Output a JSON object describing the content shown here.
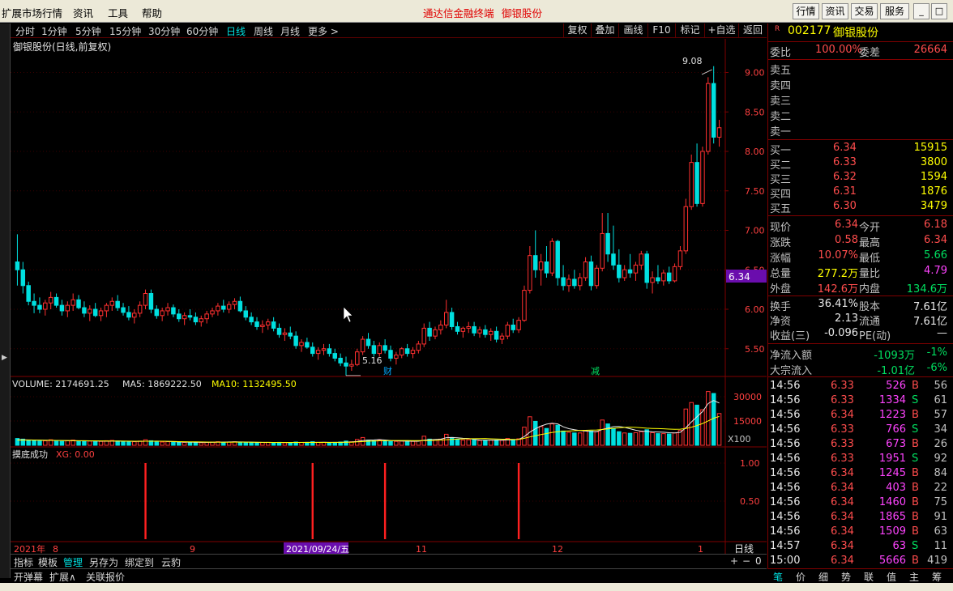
{
  "menubar": {
    "items": [
      "扩展市场行情",
      "资讯",
      "工具",
      "帮助"
    ],
    "title_app": "通达信金融终端",
    "title_stock": "御银股份",
    "right_buttons": [
      "行情",
      "资讯",
      "交易",
      "服务"
    ],
    "window_controls": [
      "_",
      "□",
      "×"
    ]
  },
  "periods": [
    "分时",
    "1分钟",
    "5分钟",
    "15分钟",
    "30分钟",
    "60分钟",
    "日线",
    "周线",
    "月线",
    "更多 >"
  ],
  "active_period": "日线",
  "toolbar": [
    "复权",
    "叠加",
    "画线",
    "F10",
    "标记",
    "+自选",
    "返回"
  ],
  "chart_title": "御银股份(日线,前复权)",
  "chart_data": {
    "type": "candlestick",
    "price_axis": [
      "9.00",
      "8.50",
      "8.00",
      "7.50",
      "7.00",
      "6.50",
      "6.00",
      "5.50"
    ],
    "price_ylim": [
      5.2,
      9.2
    ],
    "current_price_label": "6.34",
    "annotations": {
      "high": "9.08",
      "low": "5.16",
      "markers": [
        "财",
        "减"
      ]
    },
    "volume_label": "VOLUME: 2174691.25",
    "ma5_label": "MA5: 1869222.50",
    "ma10_label": "MA10: 1132495.50",
    "volume_axis": [
      "30000",
      "15000"
    ],
    "volume_unit": "X100",
    "indicator_title": "摸底成功",
    "indicator_value": "XG: 0.00",
    "indicator_axis": [
      "1.00",
      "0.50"
    ],
    "x_labels": [
      "2021年",
      "8",
      "9",
      "2021/09/24/五",
      "11",
      "12",
      "1"
    ],
    "period_label": "日线",
    "candles": [
      [
        6.6,
        6.95,
        6.3,
        6.5
      ],
      [
        6.5,
        6.6,
        6.2,
        6.3
      ],
      [
        6.3,
        6.35,
        6.05,
        6.1
      ],
      [
        6.1,
        6.2,
        5.95,
        6.05
      ],
      [
        6.05,
        6.15,
        5.95,
        6.0
      ],
      [
        6.0,
        6.12,
        5.92,
        6.08
      ],
      [
        6.08,
        6.22,
        6.0,
        6.15
      ],
      [
        6.15,
        6.2,
        6.02,
        6.05
      ],
      [
        6.05,
        6.12,
        5.92,
        5.98
      ],
      [
        5.98,
        6.1,
        5.9,
        6.05
      ],
      [
        6.05,
        6.2,
        5.98,
        6.12
      ],
      [
        6.12,
        6.18,
        6.0,
        6.02
      ],
      [
        6.02,
        6.1,
        5.9,
        5.95
      ],
      [
        5.95,
        6.05,
        5.85,
        6.0
      ],
      [
        6.0,
        6.08,
        5.9,
        5.92
      ],
      [
        5.92,
        6.02,
        5.85,
        5.98
      ],
      [
        5.98,
        6.08,
        5.9,
        6.05
      ],
      [
        6.05,
        6.15,
        5.98,
        6.1
      ],
      [
        6.1,
        6.18,
        5.98,
        6.02
      ],
      [
        6.02,
        6.08,
        5.92,
        5.96
      ],
      [
        5.96,
        6.04,
        5.86,
        5.9
      ],
      [
        5.9,
        6.0,
        5.82,
        5.95
      ],
      [
        5.95,
        6.1,
        5.9,
        6.05
      ],
      [
        6.05,
        6.25,
        6.0,
        6.2
      ],
      [
        6.2,
        6.25,
        5.95,
        6.0
      ],
      [
        6.0,
        6.05,
        5.88,
        5.92
      ],
      [
        5.92,
        6.02,
        5.85,
        5.98
      ],
      [
        5.98,
        6.08,
        5.92,
        6.02
      ],
      [
        6.02,
        6.06,
        5.9,
        5.94
      ],
      [
        5.94,
        6.0,
        5.84,
        5.88
      ],
      [
        5.88,
        5.96,
        5.8,
        5.92
      ],
      [
        5.92,
        6.0,
        5.86,
        5.9
      ],
      [
        5.9,
        5.96,
        5.8,
        5.84
      ],
      [
        5.84,
        5.92,
        5.78,
        5.88
      ],
      [
        5.88,
        5.98,
        5.82,
        5.94
      ],
      [
        5.94,
        6.02,
        5.9,
        5.98
      ],
      [
        5.98,
        6.08,
        5.92,
        6.04
      ],
      [
        6.04,
        6.12,
        5.96,
        6.0
      ],
      [
        6.0,
        6.1,
        5.95,
        6.06
      ],
      [
        6.06,
        6.14,
        6.0,
        6.1
      ],
      [
        6.1,
        6.16,
        5.96,
        5.98
      ],
      [
        5.98,
        6.04,
        5.86,
        5.9
      ],
      [
        5.9,
        5.96,
        5.8,
        5.84
      ],
      [
        5.84,
        5.9,
        5.74,
        5.78
      ],
      [
        5.78,
        5.86,
        5.7,
        5.8
      ],
      [
        5.8,
        5.88,
        5.74,
        5.84
      ],
      [
        5.84,
        5.9,
        5.72,
        5.76
      ],
      [
        5.76,
        5.82,
        5.64,
        5.68
      ],
      [
        5.68,
        5.76,
        5.6,
        5.7
      ],
      [
        5.7,
        5.78,
        5.62,
        5.66
      ],
      [
        5.66,
        5.72,
        5.5,
        5.54
      ],
      [
        5.54,
        5.62,
        5.46,
        5.58
      ],
      [
        5.58,
        5.64,
        5.5,
        5.52
      ],
      [
        5.52,
        5.58,
        5.4,
        5.44
      ],
      [
        5.44,
        5.52,
        5.36,
        5.48
      ],
      [
        5.48,
        5.56,
        5.42,
        5.5
      ],
      [
        5.5,
        5.56,
        5.4,
        5.44
      ],
      [
        5.44,
        5.5,
        5.34,
        5.38
      ],
      [
        5.38,
        5.44,
        5.28,
        5.32
      ],
      [
        5.32,
        5.4,
        5.16,
        5.28
      ],
      [
        5.28,
        5.36,
        5.22,
        5.3
      ],
      [
        5.3,
        5.5,
        5.28,
        5.46
      ],
      [
        5.46,
        5.66,
        5.42,
        5.62
      ],
      [
        5.62,
        5.7,
        5.5,
        5.54
      ],
      [
        5.54,
        5.6,
        5.4,
        5.44
      ],
      [
        5.44,
        5.58,
        5.4,
        5.54
      ],
      [
        5.54,
        5.62,
        5.44,
        5.48
      ],
      [
        5.48,
        5.54,
        5.34,
        5.38
      ],
      [
        5.38,
        5.46,
        5.3,
        5.42
      ],
      [
        5.42,
        5.52,
        5.38,
        5.5
      ],
      [
        5.5,
        5.56,
        5.4,
        5.44
      ],
      [
        5.44,
        5.52,
        5.38,
        5.48
      ],
      [
        5.48,
        5.6,
        5.44,
        5.56
      ],
      [
        5.56,
        5.82,
        5.52,
        5.76
      ],
      [
        5.76,
        5.84,
        5.6,
        5.66
      ],
      [
        5.66,
        5.78,
        5.62,
        5.74
      ],
      [
        5.74,
        5.86,
        5.68,
        5.8
      ],
      [
        5.8,
        6.12,
        5.76,
        5.96
      ],
      [
        5.96,
        6.02,
        5.74,
        5.78
      ],
      [
        5.78,
        5.84,
        5.68,
        5.72
      ],
      [
        5.72,
        5.78,
        5.64,
        5.76
      ],
      [
        5.76,
        5.84,
        5.7,
        5.78
      ],
      [
        5.78,
        5.84,
        5.66,
        5.7
      ],
      [
        5.7,
        5.78,
        5.64,
        5.74
      ],
      [
        5.74,
        5.8,
        5.64,
        5.68
      ],
      [
        5.68,
        5.76,
        5.6,
        5.72
      ],
      [
        5.72,
        5.78,
        5.58,
        5.62
      ],
      [
        5.62,
        5.7,
        5.56,
        5.66
      ],
      [
        5.66,
        5.84,
        5.62,
        5.8
      ],
      [
        5.8,
        5.88,
        5.7,
        5.74
      ],
      [
        5.74,
        5.9,
        5.7,
        5.86
      ],
      [
        5.86,
        6.3,
        5.84,
        6.24
      ],
      [
        6.24,
        6.8,
        6.2,
        6.68
      ],
      [
        6.68,
        7.0,
        6.4,
        6.5
      ],
      [
        6.5,
        6.7,
        6.3,
        6.6
      ],
      [
        6.6,
        6.8,
        6.4,
        6.46
      ],
      [
        6.46,
        6.9,
        6.42,
        6.86
      ],
      [
        6.86,
        6.88,
        6.3,
        6.4
      ],
      [
        6.4,
        6.56,
        6.24,
        6.3
      ],
      [
        6.3,
        6.44,
        6.22,
        6.38
      ],
      [
        6.38,
        6.5,
        6.26,
        6.3
      ],
      [
        6.3,
        6.46,
        6.24,
        6.4
      ],
      [
        6.4,
        6.66,
        6.36,
        6.6
      ],
      [
        6.6,
        6.68,
        6.24,
        6.3
      ],
      [
        6.3,
        6.56,
        6.26,
        6.52
      ],
      [
        6.52,
        7.22,
        6.48,
        6.96
      ],
      [
        6.96,
        7.22,
        6.6,
        6.7
      ],
      [
        6.7,
        7.06,
        6.5,
        6.56
      ],
      [
        6.56,
        6.76,
        6.34,
        6.4
      ],
      [
        6.4,
        6.56,
        6.36,
        6.5
      ],
      [
        6.5,
        6.7,
        6.4,
        6.46
      ],
      [
        6.46,
        6.6,
        6.36,
        6.56
      ],
      [
        6.56,
        6.74,
        6.5,
        6.7
      ],
      [
        6.7,
        6.74,
        6.26,
        6.34
      ],
      [
        6.34,
        6.48,
        6.2,
        6.4
      ],
      [
        6.4,
        6.56,
        6.32,
        6.36
      ],
      [
        6.36,
        6.5,
        6.3,
        6.46
      ],
      [
        6.46,
        6.54,
        6.32,
        6.36
      ],
      [
        6.36,
        6.58,
        6.34,
        6.54
      ],
      [
        6.54,
        6.8,
        6.5,
        6.74
      ],
      [
        6.74,
        7.4,
        6.7,
        7.3
      ],
      [
        7.3,
        7.96,
        7.26,
        7.86
      ],
      [
        7.86,
        8.1,
        7.3,
        7.34
      ],
      [
        7.34,
        8.06,
        7.3,
        8.0
      ],
      [
        8.0,
        8.94,
        7.96,
        8.86
      ],
      [
        8.86,
        9.08,
        8.1,
        8.18
      ],
      [
        8.18,
        8.4,
        8.06,
        8.3
      ]
    ],
    "volumes": [
      2100,
      1900,
      1600,
      1500,
      1300,
      1400,
      1700,
      1500,
      1200,
      1400,
      1600,
      1300,
      1200,
      1300,
      1100,
      1200,
      1400,
      1500,
      1300,
      1100,
      1000,
      1100,
      1300,
      1700,
      1400,
      1100,
      1000,
      1100,
      1000,
      900,
      900,
      1000,
      900,
      800,
      900,
      1000,
      1100,
      1000,
      1000,
      1100,
      1000,
      900,
      900,
      800,
      900,
      900,
      800,
      900,
      800,
      800,
      1000,
      900,
      900,
      1100,
      900,
      900,
      800,
      900,
      1000,
      1300,
      1100,
      1800,
      2400,
      1600,
      1400,
      1500,
      1300,
      1200,
      1200,
      1300,
      1100,
      1200,
      1400,
      2800,
      1900,
      1700,
      1900,
      3400,
      2400,
      1800,
      1600,
      1700,
      1600,
      1500,
      1500,
      1600,
      1600,
      1500,
      2100,
      1700,
      2000,
      5600,
      8800,
      7400,
      5800,
      5200,
      6600,
      6200,
      4400,
      4000,
      3800,
      3800,
      4600,
      4400,
      4200,
      7800,
      6600,
      5200,
      4200,
      3800,
      3700,
      3900,
      4200,
      4800,
      3900,
      3600,
      3600,
      3500,
      3800,
      4600,
      11200,
      13200,
      12400,
      11000,
      16600,
      16000,
      9800
    ],
    "ma5": [
      1700,
      1680,
      1660,
      1640,
      1600,
      1560,
      1520,
      1500,
      1460,
      1420,
      1400,
      1380,
      1360,
      1340,
      1300,
      1280,
      1260,
      1280,
      1300,
      1280,
      1240,
      1200,
      1200,
      1240,
      1260,
      1280,
      1260,
      1200,
      1140,
      1040,
      980,
      960,
      940,
      920,
      900,
      920,
      960,
      980,
      1020,
      1060,
      1040,
      1000,
      960,
      920,
      880,
      860,
      860,
      860,
      840,
      840,
      860,
      880,
      900,
      920,
      920,
      940,
      920,
      900,
      920,
      980,
      1020,
      1200,
      1440,
      1580,
      1660,
      1780,
      1640,
      1460,
      1360,
      1320,
      1280,
      1260,
      1260,
      1600,
      1700,
      1780,
      1880,
      2340,
      2420,
      2320,
      2160,
      2080,
      1800,
      1640,
      1600,
      1580,
      1560,
      1560,
      1660,
      1700,
      1800,
      2680,
      4040,
      5100,
      5940,
      6520,
      6800,
      6600,
      5700,
      5120,
      4800,
      4520,
      4400,
      4240,
      4200,
      4900,
      5300,
      5760,
      5820,
      5540,
      5100,
      4660,
      4360,
      4280,
      4160,
      4080,
      4020,
      3880,
      3800,
      4000,
      5400,
      7200,
      8800,
      10400,
      12880,
      13840,
      13040
    ],
    "ma10": [
      1600,
      1600,
      1600,
      1580,
      1560,
      1540,
      1520,
      1500,
      1480,
      1460,
      1440,
      1420,
      1400,
      1380,
      1360,
      1340,
      1320,
      1310,
      1300,
      1290,
      1280,
      1260,
      1240,
      1240,
      1250,
      1260,
      1250,
      1220,
      1190,
      1140,
      1100,
      1070,
      1050,
      1030,
      1000,
      980,
      960,
      950,
      950,
      960,
      970,
      960,
      950,
      930,
      910,
      900,
      890,
      880,
      870,
      860,
      860,
      860,
      860,
      870,
      880,
      890,
      890,
      890,
      900,
      930,
      950,
      1050,
      1170,
      1260,
      1320,
      1380,
      1420,
      1440,
      1460,
      1480,
      1470,
      1450,
      1440,
      1460,
      1500,
      1540,
      1600,
      1720,
      1820,
      1900,
      1960,
      2020,
      2040,
      2060,
      2080,
      2000,
      1950,
      1880,
      1840,
      1820,
      1790,
      2160,
      2580,
      2950,
      3300,
      3620,
      3980,
      4200,
      4340,
      4420,
      4500,
      4580,
      4640,
      4680,
      4720,
      4860,
      5050,
      5220,
      5380,
      5530,
      5600,
      5520,
      5400,
      5280,
      5200,
      5150,
      5080,
      5010,
      4950,
      4960,
      5180,
      5560,
      6100,
      6720,
      7520,
      8340,
      8900
    ],
    "signal_days": [
      23,
      53,
      90
    ]
  },
  "quote": {
    "code_prefix": "R",
    "code": "002177",
    "name": "御银股份",
    "weibi_label": "委比",
    "weibi": "100.00%",
    "weicha_label": "委差",
    "weicha": "26664",
    "sells": [
      {
        "label": "卖五",
        "price": "",
        "vol": ""
      },
      {
        "label": "卖四",
        "price": "",
        "vol": ""
      },
      {
        "label": "卖三",
        "price": "",
        "vol": ""
      },
      {
        "label": "卖二",
        "price": "",
        "vol": ""
      },
      {
        "label": "卖一",
        "price": "",
        "vol": ""
      }
    ],
    "buys": [
      {
        "label": "买一",
        "price": "6.34",
        "vol": "15915"
      },
      {
        "label": "买二",
        "price": "6.33",
        "vol": "3800"
      },
      {
        "label": "买三",
        "price": "6.32",
        "vol": "1594"
      },
      {
        "label": "买四",
        "price": "6.31",
        "vol": "1876"
      },
      {
        "label": "买五",
        "price": "6.30",
        "vol": "3479"
      }
    ],
    "stats": [
      {
        "l1": "现价",
        "v1": "6.34",
        "c1": "red",
        "l2": "今开",
        "v2": "6.18",
        "c2": "red"
      },
      {
        "l1": "涨跌",
        "v1": "0.58",
        "c1": "red",
        "l2": "最高",
        "v2": "6.34",
        "c2": "red"
      },
      {
        "l1": "涨幅",
        "v1": "10.07%",
        "c1": "red",
        "l2": "最低",
        "v2": "5.66",
        "c2": "grn"
      },
      {
        "l1": "总量",
        "v1": "277.2万",
        "c1": "yel",
        "l2": "量比",
        "v2": "4.79",
        "c2": "mag"
      },
      {
        "l1": "外盘",
        "v1": "142.6万",
        "c1": "red",
        "l2": "内盘",
        "v2": "134.6万",
        "c2": "grn"
      }
    ],
    "stats2": [
      {
        "l1": "换手",
        "v1": "36.41%",
        "l2": "股本",
        "v2": "7.61亿"
      },
      {
        "l1": "净资",
        "v1": "2.13",
        "l2": "流通",
        "v2": "7.61亿"
      },
      {
        "l1": "收益(三)",
        "v1": "-0.096",
        "l2": "PE(动)",
        "v2": "—"
      }
    ],
    "flow": [
      {
        "label": "净流入额",
        "val": "-1093万",
        "pct": "-1%"
      },
      {
        "label": "大宗流入",
        "val": "-1.01亿",
        "pct": "-6%"
      }
    ],
    "ticks": [
      {
        "t": "14:56",
        "p": "6.33",
        "v": "526",
        "d": "B",
        "n": "56"
      },
      {
        "t": "14:56",
        "p": "6.33",
        "v": "1334",
        "d": "S",
        "n": "61"
      },
      {
        "t": "14:56",
        "p": "6.34",
        "v": "1223",
        "d": "B",
        "n": "57"
      },
      {
        "t": "14:56",
        "p": "6.33",
        "v": "766",
        "d": "S",
        "n": "34"
      },
      {
        "t": "14:56",
        "p": "6.33",
        "v": "673",
        "d": "B",
        "n": "26"
      },
      {
        "t": "14:56",
        "p": "6.33",
        "v": "1951",
        "d": "S",
        "n": "92"
      },
      {
        "t": "14:56",
        "p": "6.34",
        "v": "1245",
        "d": "B",
        "n": "84"
      },
      {
        "t": "14:56",
        "p": "6.34",
        "v": "403",
        "d": "B",
        "n": "22"
      },
      {
        "t": "14:56",
        "p": "6.34",
        "v": "1460",
        "d": "B",
        "n": "75"
      },
      {
        "t": "14:56",
        "p": "6.34",
        "v": "1865",
        "d": "B",
        "n": "91"
      },
      {
        "t": "14:56",
        "p": "6.34",
        "v": "1509",
        "d": "B",
        "n": "63"
      },
      {
        "t": "14:57",
        "p": "6.34",
        "v": "63",
        "d": "S",
        "n": "11"
      },
      {
        "t": "15:00",
        "p": "6.34",
        "v": "5666",
        "d": "B",
        "n": "419"
      }
    ]
  },
  "bottom_tabs": [
    "指标",
    "模板",
    "管理",
    "另存为",
    "绑定到",
    "云豹"
  ],
  "bottom_right": [
    "+",
    "−",
    "0"
  ],
  "status_items": [
    "开弹幕",
    "扩展∧",
    "关联报价"
  ],
  "right_tabs": [
    "笔",
    "价",
    "细",
    "势",
    "联",
    "值",
    "主",
    "筹"
  ]
}
